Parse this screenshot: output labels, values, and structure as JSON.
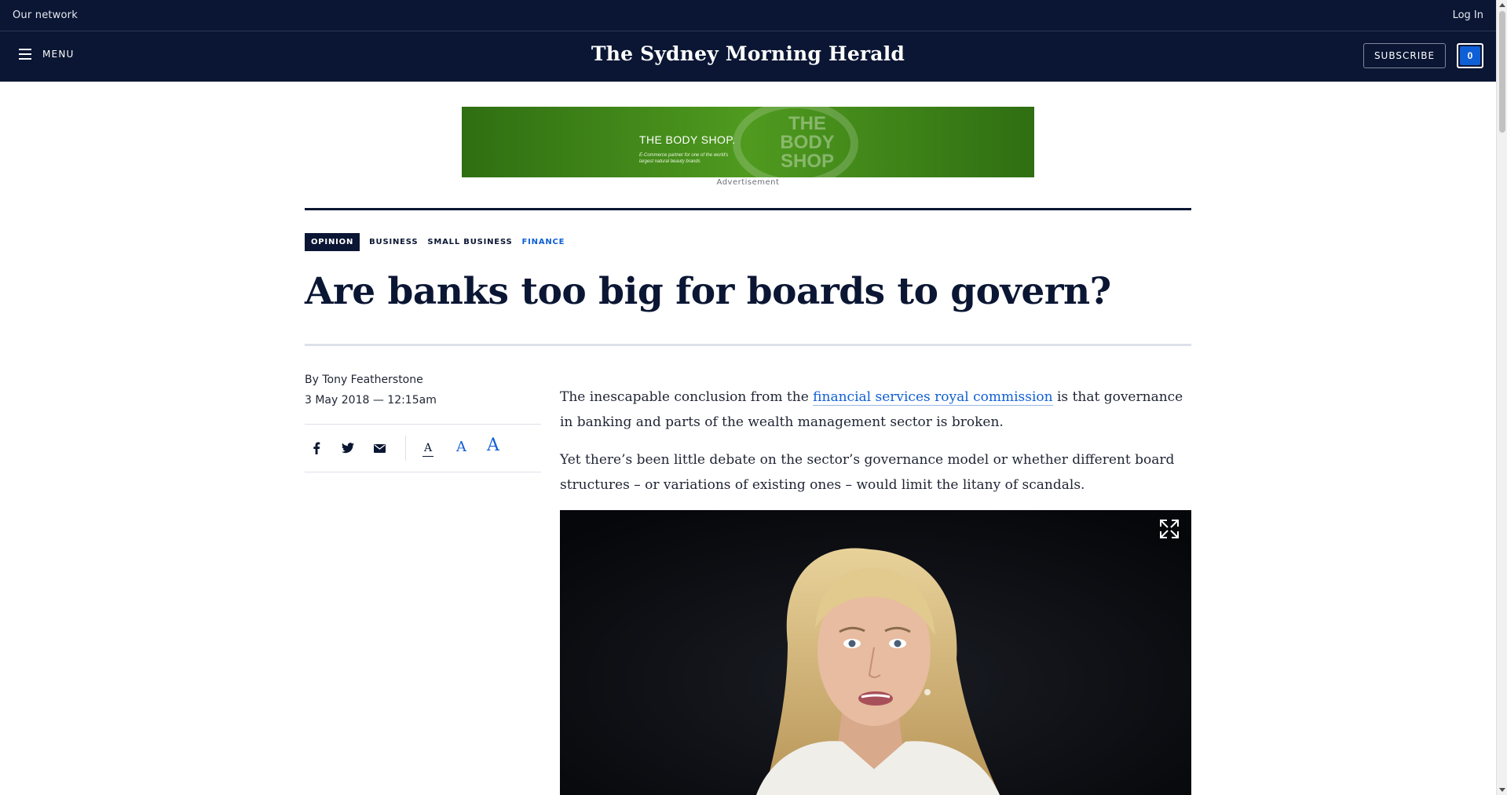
{
  "network_bar": {
    "left_label": "Our network",
    "login_label": "Log In"
  },
  "masthead": {
    "menu_label": "MENU",
    "logo_text": "The Sydney Morning Herald",
    "subscribe_label": "SUBSCRIBE",
    "count_badge": "0"
  },
  "advert": {
    "brand": "THE BODY SHOP.",
    "tagline": "E-Commerce partner for one of the world's largest natural beauty brands",
    "watermark": "THE BODY SHOP",
    "label": "Advertisement"
  },
  "article": {
    "tags": [
      {
        "label": "OPINION"
      },
      {
        "label": "BUSINESS"
      },
      {
        "label": "SMALL BUSINESS"
      },
      {
        "label": "FINANCE"
      }
    ],
    "headline": "Are banks too big for boards to govern?",
    "byline": "By Tony Featherstone",
    "date": "3 May 2018 — 12:15am",
    "share_icons": [
      "facebook-icon",
      "twitter-icon",
      "email-icon"
    ],
    "text_size_label": "A",
    "paragraph_1": {
      "before": "The inescapable conclusion from the ",
      "link": "financial services royal commission",
      "after": " is that governance in banking and parts of the wealth management sector is broken."
    },
    "paragraph_2": "Yet there’s been little debate on the sector’s governance model or whether different board structures – or variations of existing ones – would limit the litany of scandals."
  },
  "colors": {
    "brand_navy": "#0a1633",
    "accent_blue": "#0f5fd6",
    "rule_grey": "#dde1ea"
  }
}
